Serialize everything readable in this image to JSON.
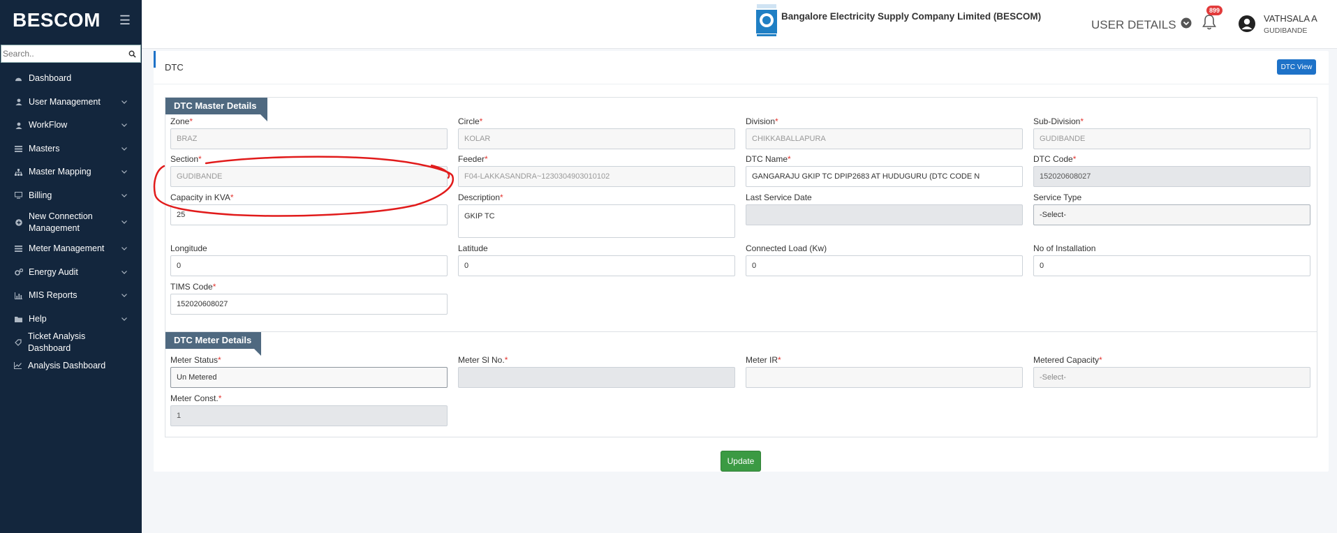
{
  "sidebar": {
    "brand": "BESCOM",
    "search_placeholder": "Search..",
    "items": [
      {
        "label": "Dashboard",
        "icon": "dashboard-icon"
      },
      {
        "label": "User Management",
        "icon": "user-icon"
      },
      {
        "label": "WorkFlow",
        "icon": "user-icon"
      },
      {
        "label": "Masters",
        "icon": "list-icon"
      },
      {
        "label": "Master Mapping",
        "icon": "sitemap-icon"
      },
      {
        "label": "Billing",
        "icon": "monitor-icon"
      },
      {
        "label": "New Connection Management",
        "icon": "plus-circle-icon"
      },
      {
        "label": "Meter Management",
        "icon": "list-icon"
      },
      {
        "label": "Energy Audit",
        "icon": "cogs-icon"
      },
      {
        "label": "MIS Reports",
        "icon": "bar-chart-icon"
      },
      {
        "label": "Help",
        "icon": "folder-icon"
      },
      {
        "label": "Ticket Analysis Dashboard",
        "icon": "tag-icon"
      },
      {
        "label": "Analysis Dashboard",
        "icon": "line-chart-icon"
      }
    ]
  },
  "header": {
    "company": "Bangalore Electricity Supply Company Limited (BESCOM)",
    "user_details_label": "USER DETAILS",
    "notification_count": "899",
    "user_name": "VATHSALA A",
    "user_location": "GUDIBANDE"
  },
  "page": {
    "title": "DTC",
    "dtc_view_button": "DTC View",
    "update_button": "Update"
  },
  "master": {
    "legend": "DTC Master Details",
    "zone": {
      "label": "Zone",
      "value": "BRAZ"
    },
    "circle": {
      "label": "Circle",
      "value": "KOLAR"
    },
    "division": {
      "label": "Division",
      "value": "CHIKKABALLAPURA"
    },
    "subdivision": {
      "label": "Sub-Division",
      "value": "GUDIBANDE"
    },
    "section": {
      "label": "Section",
      "value": "GUDIBANDE"
    },
    "feeder": {
      "label": "Feeder",
      "value": "F04-LAKKASANDRA~1230304903010102"
    },
    "dtc_name": {
      "label": "DTC Name",
      "value": "GANGARAJU GKIP TC DPIP2683 AT HUDUGURU (DTC CODE N"
    },
    "dtc_code": {
      "label": "DTC Code",
      "value": "152020608027"
    },
    "capacity": {
      "label": "Capacity in KVA",
      "value": "25"
    },
    "description": {
      "label": "Description",
      "value": "GKIP TC"
    },
    "last_service_date": {
      "label": "Last Service Date",
      "value": ""
    },
    "service_type": {
      "label": "Service Type",
      "value": "-Select-"
    },
    "longitude": {
      "label": "Longitude",
      "value": "0"
    },
    "latitude": {
      "label": "Latitude",
      "value": "0"
    },
    "connected_load": {
      "label": "Connected Load (Kw)",
      "value": "0"
    },
    "no_installation": {
      "label": "No of Installation",
      "value": "0"
    },
    "tims_code": {
      "label": "TIMS Code",
      "value": "152020608027"
    }
  },
  "meter": {
    "legend": "DTC Meter Details",
    "meter_status": {
      "label": "Meter Status",
      "value": "Un Metered"
    },
    "meter_sl": {
      "label": "Meter Sl No.",
      "value": ""
    },
    "meter_ir": {
      "label": "Meter IR",
      "value": ""
    },
    "metered_capacity": {
      "label": "Metered Capacity",
      "value": "-Select-"
    },
    "meter_const": {
      "label": "Meter Const.",
      "value": "1"
    }
  },
  "colors": {
    "sidebar_bg": "#13263d",
    "primary": "#1e72c8",
    "legend_bg": "#4f6980",
    "update_green": "#3b9a43",
    "required_red": "#e3342f",
    "annotation_red": "#e11b1b"
  }
}
